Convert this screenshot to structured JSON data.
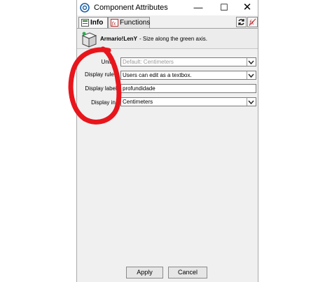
{
  "window": {
    "title": "Component Attributes",
    "controls": {
      "minimize": "—",
      "maximize": "☐",
      "close": "✕"
    }
  },
  "tabs": [
    {
      "label": "Info",
      "active": true
    },
    {
      "label": "Functions",
      "active": false
    }
  ],
  "header": {
    "attribute_name": "Armario!LenY",
    "description": "- Size along the green axis."
  },
  "form": {
    "units": {
      "label": "Units:",
      "value": "Default: Centimeters"
    },
    "display_rule": {
      "label": "Display rule:",
      "value": "Users can edit as a textbox."
    },
    "display_label": {
      "label": "Display label:",
      "value": "profundidade"
    },
    "display_in": {
      "label": "Display in:",
      "value": "Centimeters"
    }
  },
  "buttons": {
    "apply": "Apply",
    "cancel": "Cancel"
  },
  "annotation_color": "#e8161c"
}
